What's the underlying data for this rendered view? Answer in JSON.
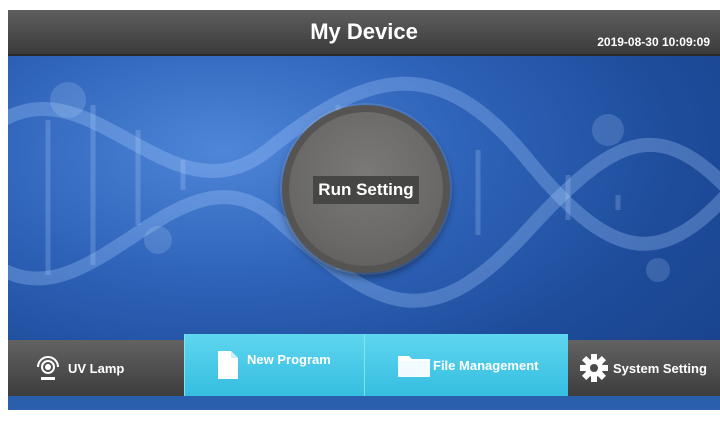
{
  "header": {
    "title": "My Device",
    "datetime": "2019-08-30 10:09:09"
  },
  "main": {
    "run_button_label": "Run Setting"
  },
  "bottom_bar": {
    "items": [
      {
        "label": "UV Lamp",
        "icon": "uv-lamp-icon",
        "style": "gray"
      },
      {
        "label": "New Program",
        "icon": "document-icon",
        "style": "cyan"
      },
      {
        "label": "File Management",
        "icon": "folder-icon",
        "style": "cyan"
      },
      {
        "label": "System Setting",
        "icon": "gear-icon",
        "style": "gray"
      }
    ]
  },
  "colors": {
    "header_bg": "#4a4a4a",
    "background_blue": "#2e63b9",
    "active_tab": "#35bde0",
    "run_button": "#6a6967"
  }
}
